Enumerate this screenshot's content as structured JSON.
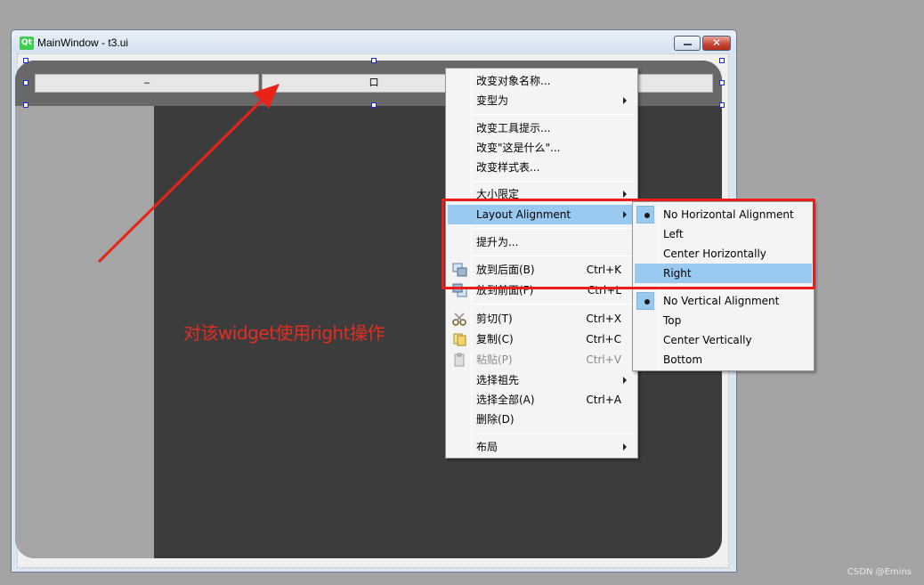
{
  "window": {
    "title": "MainWindow - t3.ui",
    "logo_text": "Qt",
    "close_glyph": "✕"
  },
  "toolbar_buttons": [
    {
      "label": "–"
    },
    {
      "label": "口"
    }
  ],
  "annotation": "对该widget使用right操作",
  "context_menu": {
    "items": [
      {
        "label": "改变对象名称..."
      },
      {
        "label": "变型为"
      },
      {
        "label": "改变工具提示..."
      },
      {
        "label": "改变\"这是什么\"..."
      },
      {
        "label": "改变样式表..."
      },
      {
        "label": "大小限定"
      },
      {
        "label": "Layout Alignment"
      },
      {
        "label": "提升为..."
      },
      {
        "label": "放到后面(B)",
        "shortcut": "Ctrl+K"
      },
      {
        "label": "放到前面(F)",
        "shortcut": "Ctrl+L"
      },
      {
        "label": "剪切(T)",
        "shortcut": "Ctrl+X"
      },
      {
        "label": "复制(C)",
        "shortcut": "Ctrl+C"
      },
      {
        "label": "粘贴(P)",
        "shortcut": "Ctrl+V"
      },
      {
        "label": "选择祖先"
      },
      {
        "label": "选择全部(A)",
        "shortcut": "Ctrl+A"
      },
      {
        "label": "删除(D)"
      },
      {
        "label": "布局"
      }
    ]
  },
  "alignment_submenu": {
    "horizontal": [
      {
        "label": "No Horizontal Alignment"
      },
      {
        "label": "Left"
      },
      {
        "label": "Center Horizontally"
      },
      {
        "label": "Right"
      }
    ],
    "vertical": [
      {
        "label": "No Vertical Alignment"
      },
      {
        "label": "Top"
      },
      {
        "label": "Center Vertically"
      },
      {
        "label": "Bottom"
      }
    ]
  },
  "watermark": "CSDN @Emins",
  "colors": {
    "highlight": "#99c9ef",
    "annotation_red": "#e22d22",
    "frame_dark": "#3c3c3c"
  }
}
